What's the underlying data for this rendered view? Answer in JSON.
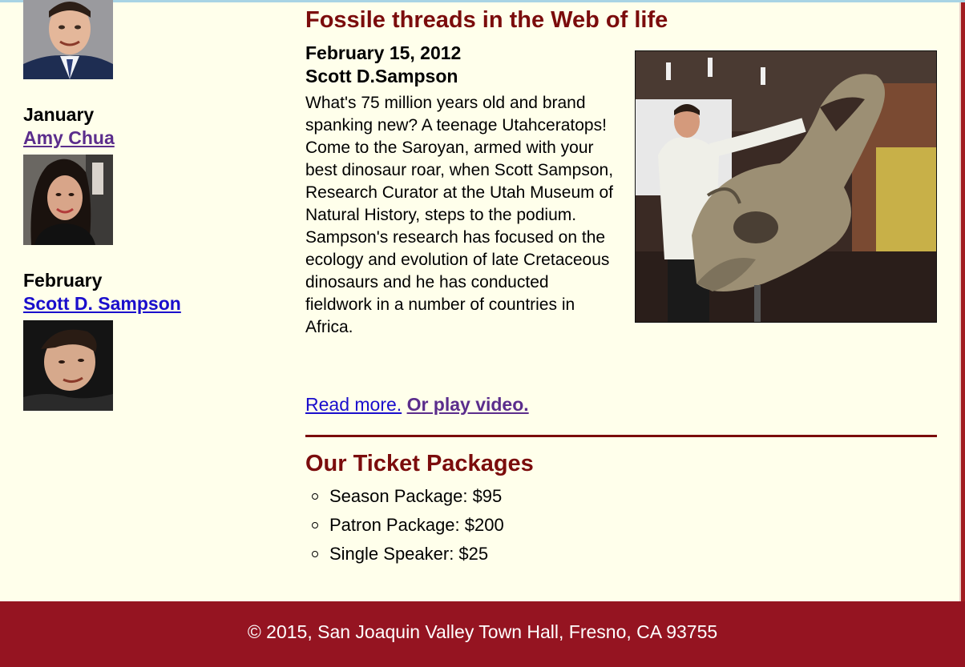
{
  "sidebar": {
    "speakers": [
      {
        "month": "",
        "name": ""
      },
      {
        "month": "January",
        "name": "Amy Chua"
      },
      {
        "month": "February",
        "name": "Scott D. Sampson"
      }
    ]
  },
  "article": {
    "title": "Fossile threads in the Web of life",
    "date": "February 15, 2012",
    "author": "Scott D.Sampson",
    "body": "What's 75 million years old and brand spanking new? A teenage Utahceratops! Come to the Saroyan, armed with your best dinosaur roar, when Scott Sampson, Research Curator at the Utah Museum of Natural History, steps to the podium. Sampson's research has focused on the ecology and evolution of late Cretaceous dinosaurs and he has conducted fieldwork in a number of countries in Africa.",
    "read_more": "Read more.",
    "play_video": "Or play video."
  },
  "packages": {
    "title": "Our Ticket Packages",
    "items": [
      "Season Package: $95",
      "Patron Package: $200",
      "Single Speaker: $25"
    ]
  },
  "footer": {
    "text": "© 2015, San Joaquin Valley Town Hall, Fresno, CA 93755"
  },
  "colors": {
    "background": "#ffffeb",
    "heading": "#7b0c0c",
    "footer": "#951421",
    "link_visited": "#5b2d8c",
    "link_unvisited": "#1a0ecc"
  }
}
